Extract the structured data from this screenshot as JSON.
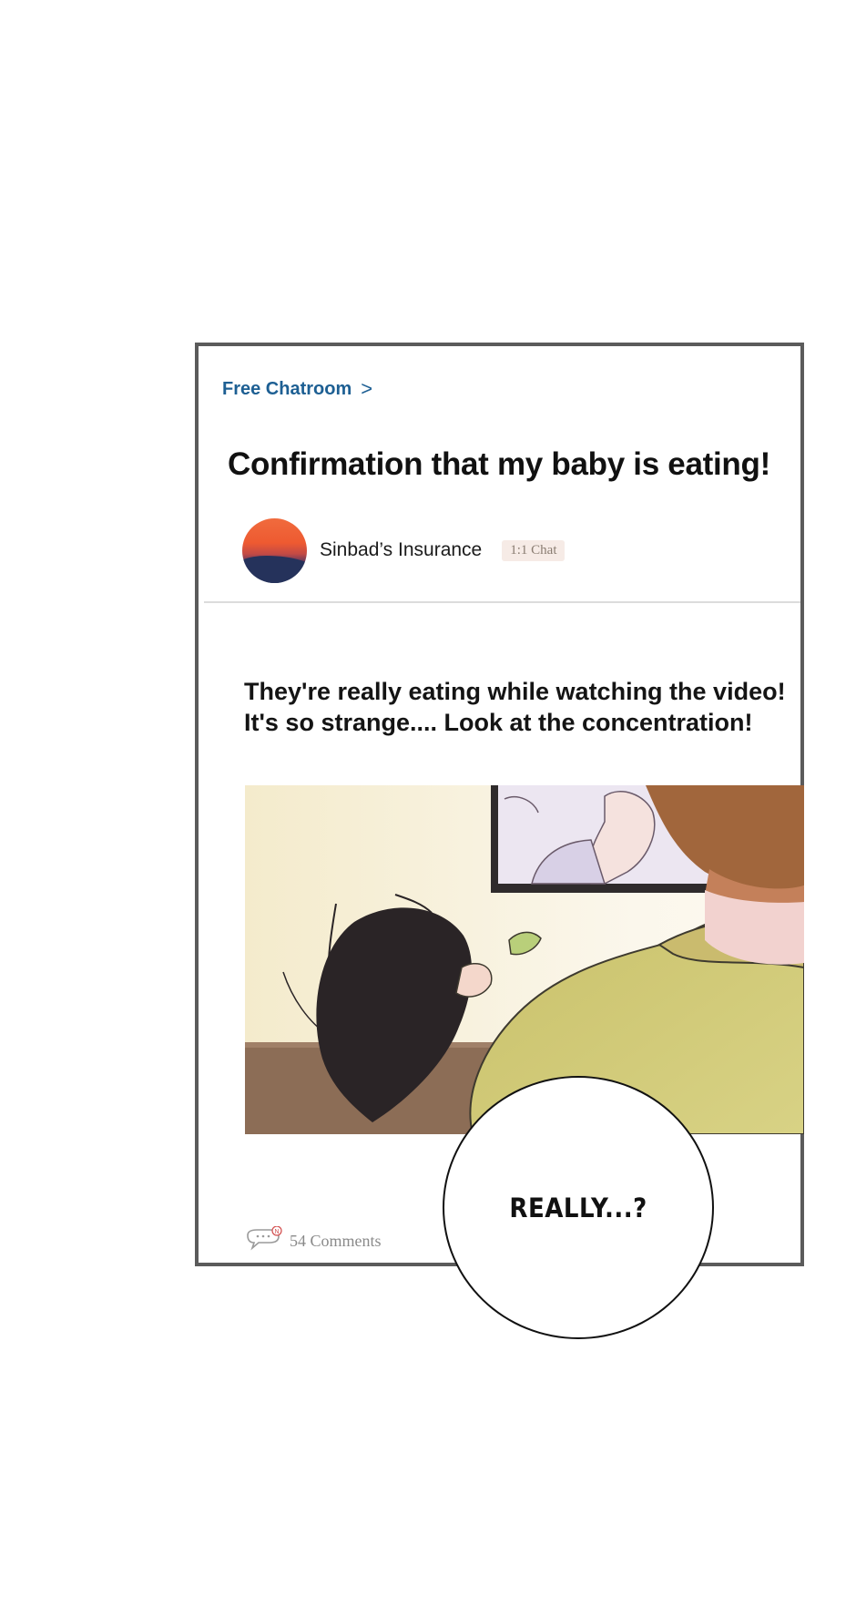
{
  "post": {
    "breadcrumb": "Free Chatroom",
    "breadcrumb_chevron": ">",
    "title": "Confirmation that my baby is eating!",
    "author": "Sinbad’s Insurance",
    "chat_badge": "1:1 Chat",
    "body_lines": [
      "They're really eating while watching the video!",
      "It's so strange.... Look at the concentration!"
    ],
    "comments": "54 Comments"
  },
  "bubble": {
    "text": "REALLY...?"
  },
  "icons": {
    "breadcrumb_chevron": "chevron-right-icon",
    "comments": "speech-bubble-icon",
    "notification": "new-badge-icon"
  },
  "colors": {
    "frame_border": "#5b5b5b",
    "breadcrumb": "#1d5f93",
    "badge_bg": "#f6ebe6",
    "badge_text": "#8a7d72"
  }
}
